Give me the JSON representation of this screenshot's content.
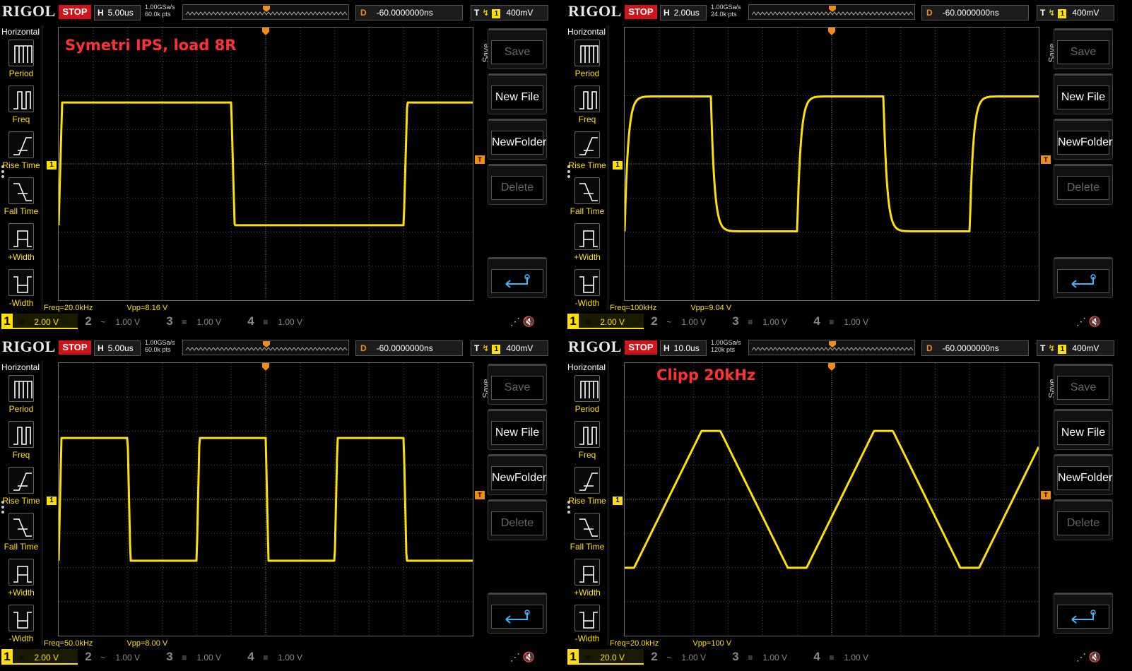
{
  "panels": [
    {
      "brand": "RIGOL",
      "run_state": "STOP",
      "timebase_label": "H",
      "timebase": "5.00us",
      "sample_rate": "1.00GSa/s",
      "memory_depth": "60.0k pts",
      "delay_label": "D",
      "delay": "-60.0000000ns",
      "trigger_label": "T",
      "trigger_source": "1",
      "trigger_level": "400mV",
      "annotation": "Symetri IPS, load 8R",
      "left_menu_title": "Horizontal",
      "left_menu_items": [
        "Period",
        "Freq",
        "Rise Time",
        "Fall Time",
        "+Width",
        "-Width"
      ],
      "right_menu_title": "Save",
      "right_menu_buttons": [
        "Save",
        "New File",
        "NewFolder",
        "Delete"
      ],
      "measurements": {
        "freq": "Freq=20.0kHz",
        "vpp": "Vpp=8.16 V"
      },
      "channels": [
        {
          "num": "1",
          "coupling": "≡",
          "scale": "2.00 V"
        },
        {
          "num": "2",
          "coupling": "~",
          "scale": "1.00 V"
        },
        {
          "num": "3",
          "coupling": "≡",
          "scale": "1.00 V"
        },
        {
          "num": "4",
          "coupling": "≡",
          "scale": "1.00 V"
        }
      ],
      "waveform": {
        "type": "square",
        "cycles": 1.2,
        "phase": 0.0,
        "rise": 0.01,
        "amplitude": 0.5
      }
    },
    {
      "brand": "RIGOL",
      "run_state": "STOP",
      "timebase_label": "H",
      "timebase": "2.00us",
      "sample_rate": "1.00GSa/s",
      "memory_depth": "24.0k pts",
      "delay_label": "D",
      "delay": "-60.0000000ns",
      "trigger_label": "T",
      "trigger_source": "1",
      "trigger_level": "400mV",
      "annotation": "",
      "left_menu_title": "Horizontal",
      "left_menu_items": [
        "Period",
        "Freq",
        "Rise Time",
        "Fall Time",
        "+Width",
        "-Width"
      ],
      "right_menu_title": "Save",
      "right_menu_buttons": [
        "Save",
        "New File",
        "NewFolder",
        "Delete"
      ],
      "measurements": {
        "freq": "Freq=100kHz",
        "vpp": "Vpp=9.04 V"
      },
      "channels": [
        {
          "num": "1",
          "coupling": "≡",
          "scale": "2.00 V"
        },
        {
          "num": "2",
          "coupling": "~",
          "scale": "1.00 V"
        },
        {
          "num": "3",
          "coupling": "≡",
          "scale": "1.00 V"
        },
        {
          "num": "4",
          "coupling": "≡",
          "scale": "1.00 V"
        }
      ],
      "waveform": {
        "type": "rounded-square",
        "cycles": 2.4,
        "phase": 0.0,
        "rise": 0.05,
        "amplitude": 0.55
      }
    },
    {
      "brand": "RIGOL",
      "run_state": "STOP",
      "timebase_label": "H",
      "timebase": "5.00us",
      "sample_rate": "1.00GSa/s",
      "memory_depth": "60.0k pts",
      "delay_label": "D",
      "delay": "-60.0000000ns",
      "trigger_label": "T",
      "trigger_source": "1",
      "trigger_level": "400mV",
      "annotation": "",
      "left_menu_title": "Horizontal",
      "left_menu_items": [
        "Period",
        "Freq",
        "Rise Time",
        "Fall Time",
        "+Width",
        "-Width"
      ],
      "right_menu_title": "Save",
      "right_menu_buttons": [
        "Save",
        "New File",
        "NewFolder",
        "Delete"
      ],
      "measurements": {
        "freq": "Freq=50.0kHz",
        "vpp": "Vpp=8.00 V"
      },
      "channels": [
        {
          "num": "1",
          "coupling": "≡",
          "scale": "2.00 V"
        },
        {
          "num": "2",
          "coupling": "~",
          "scale": "1.00 V"
        },
        {
          "num": "3",
          "coupling": "≡",
          "scale": "1.00 V"
        },
        {
          "num": "4",
          "coupling": "≡",
          "scale": "1.00 V"
        }
      ],
      "waveform": {
        "type": "square",
        "cycles": 3.0,
        "phase": 0.0,
        "rise": 0.02,
        "amplitude": 0.5
      }
    },
    {
      "brand": "RIGOL",
      "run_state": "STOP",
      "timebase_label": "H",
      "timebase": "10.0us",
      "sample_rate": "1.00GSa/s",
      "memory_depth": "120k pts",
      "delay_label": "D",
      "delay": "-60.0000000ns",
      "trigger_label": "T",
      "trigger_source": "1",
      "trigger_level": "400mV",
      "annotation": "Clipp 20kHz",
      "left_menu_title": "Horizontal",
      "left_menu_items": [
        "Period",
        "Freq",
        "Rise Time",
        "Fall Time",
        "+Width",
        "-Width"
      ],
      "right_menu_title": "Save",
      "right_menu_buttons": [
        "Save",
        "New File",
        "NewFolder",
        "Delete"
      ],
      "measurements": {
        "freq": "Freq=20.0kHz",
        "vpp": "Vpp=100 V"
      },
      "channels": [
        {
          "num": "1",
          "coupling": "≡",
          "scale": "20.0 V"
        },
        {
          "num": "2",
          "coupling": "~",
          "scale": "1.00 V"
        },
        {
          "num": "3",
          "coupling": "≡",
          "scale": "1.00 V"
        },
        {
          "num": "4",
          "coupling": "≡",
          "scale": "1.00 V"
        }
      ],
      "waveform": {
        "type": "clipped-triangle",
        "cycles": 2.4,
        "phase": 0.0,
        "rise": 0.0,
        "amplitude": 0.62
      }
    }
  ],
  "colors": {
    "trace": "#ffe000",
    "annotation": "#ff3232",
    "stop": "#d0141a",
    "trigger": "#f08c1a",
    "grid": "#4a4a4a"
  },
  "icons": {
    "back": "return-arrow-icon",
    "usb": "usb-icon",
    "mute": "speaker-mute-icon"
  }
}
